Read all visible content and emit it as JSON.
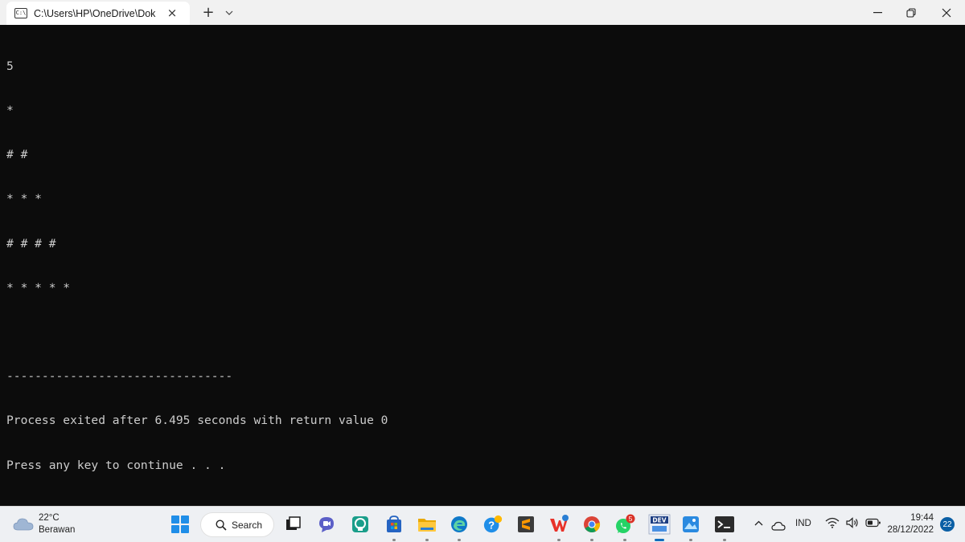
{
  "window": {
    "tab_title": "C:\\Users\\HP\\OneDrive\\Dokur",
    "tab_icon_text": "C:\\",
    "close_tab_glyph": "×",
    "new_tab_glyph": "+",
    "dropdown_glyph": "⌄",
    "minimize_glyph": "—",
    "restore_glyph": "❐",
    "close_glyph": "✕"
  },
  "console": {
    "lines": [
      "5",
      "*",
      "# #",
      "* * *",
      "# # # #",
      "* * * * *",
      "",
      "--------------------------------",
      "Process exited after 6.495 seconds with return value 0",
      "Press any key to continue . . ."
    ]
  },
  "taskbar": {
    "weather": {
      "temperature": "22°C",
      "condition": "Berawan",
      "icon": "cloud-icon"
    },
    "search_label": "Search",
    "apps": [
      {
        "name": "task-view-icon",
        "color": "#333333"
      },
      {
        "name": "chat-icon",
        "color": "#5b5fc7"
      },
      {
        "name": "app-icon",
        "color": "#1a9e8a"
      },
      {
        "name": "microsoft-store-icon",
        "color": "#2564c2"
      },
      {
        "name": "file-explorer-icon",
        "color": "#f4b400"
      },
      {
        "name": "edge-icon",
        "color": "#0f79c8"
      },
      {
        "name": "help-icon",
        "color": "#1f8ee8"
      },
      {
        "name": "sublime-text-icon",
        "color": "#ff8a00"
      },
      {
        "name": "wps-office-icon",
        "color": "#e8322a"
      },
      {
        "name": "chrome-icon",
        "color": "#34a853"
      },
      {
        "name": "whatsapp-icon",
        "color": "#25d366",
        "badge": "5"
      },
      {
        "name": "dev-cpp-icon",
        "color": "#1c3d82",
        "label": "DEV"
      },
      {
        "name": "photos-icon",
        "color": "#2a8ae0"
      },
      {
        "name": "terminal-icon",
        "color": "#2b2b2b"
      }
    ],
    "tray": {
      "chevron_glyph": "^",
      "language": "IND",
      "time": "19:44",
      "date": "28/12/2022",
      "notifications": "22"
    }
  }
}
